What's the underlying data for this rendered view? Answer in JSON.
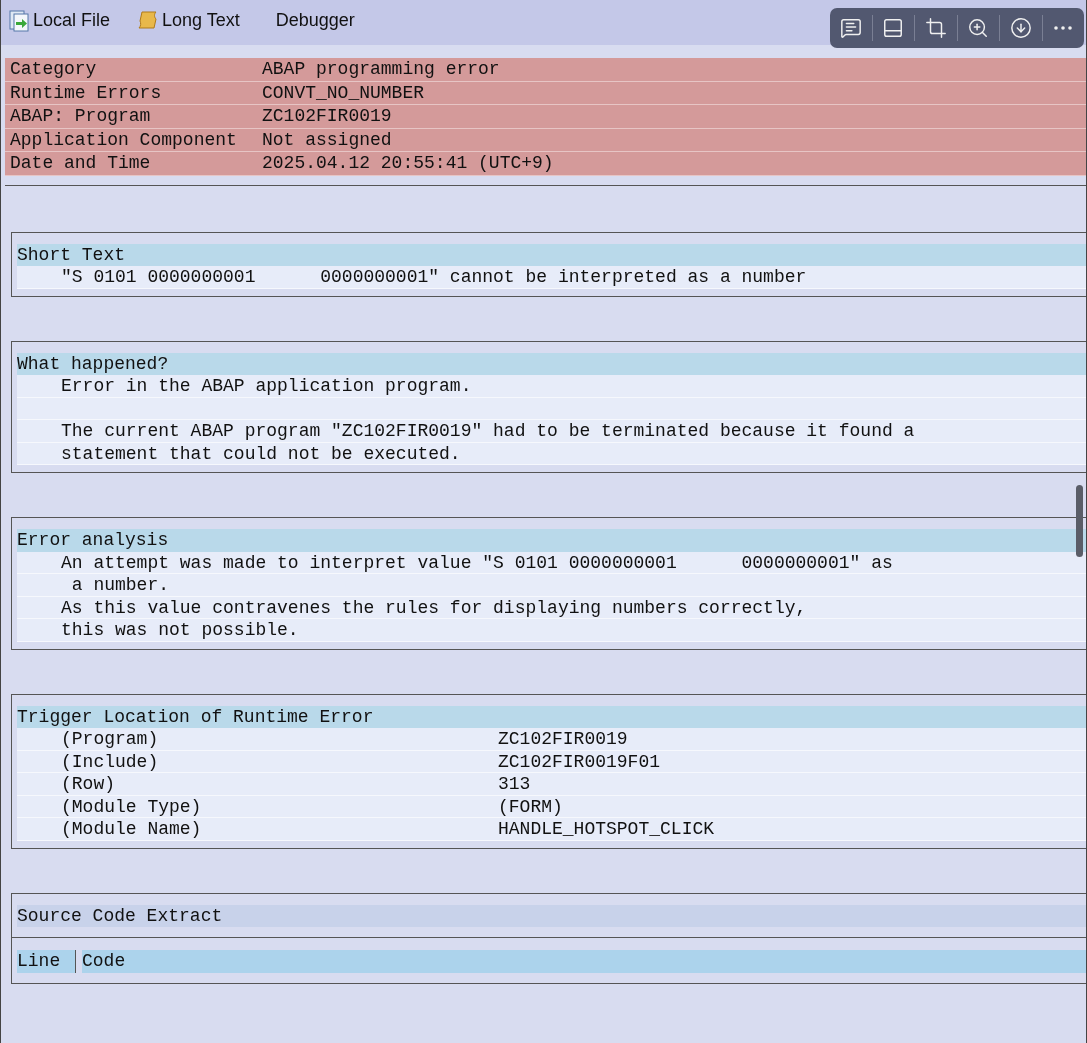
{
  "toolbar": {
    "buttons": [
      {
        "kind": "file",
        "label": "Local File"
      },
      {
        "kind": "scroll",
        "label": "Long Text"
      },
      {
        "kind": "plain",
        "label": "Debugger"
      }
    ]
  },
  "header": [
    {
      "label": "Category",
      "value": "ABAP programming error"
    },
    {
      "label": "Runtime Errors",
      "value": "CONVT_NO_NUMBER"
    },
    {
      "label": "ABAP: Program",
      "value": "ZC102FIR0019"
    },
    {
      "label": "Application Component",
      "value": "Not assigned"
    },
    {
      "label": "Date and Time",
      "value": "2025.04.12 20:55:41 (UTC+9)"
    }
  ],
  "sections": [
    {
      "kind": "text",
      "title": "Short Text",
      "paragraphs": [
        [
          "\"S 0101 0000000001      0000000001\" cannot be interpreted as a number"
        ]
      ]
    },
    {
      "kind": "text",
      "title": "What happened?",
      "paragraphs": [
        [
          "Error in the ABAP application program."
        ],
        [
          "The current ABAP program \"ZC102FIR0019\" had to be terminated because it found a",
          "statement that could not be executed."
        ]
      ]
    },
    {
      "kind": "text",
      "title": "Error analysis",
      "paragraphs": [
        [
          "An attempt was made to interpret value \"S 0101 0000000001      0000000001\" as",
          " a number.",
          "As this value contravenes the rules for displaying numbers correctly,",
          "this was not possible."
        ]
      ]
    },
    {
      "kind": "pairs",
      "title": "Trigger Location of Runtime Error",
      "rows": [
        {
          "label": "(Program)",
          "value": "ZC102FIR0019"
        },
        {
          "label": "(Include)",
          "value": "ZC102FIR0019F01"
        },
        {
          "label": "(Row)",
          "value": "313"
        },
        {
          "label": "(Module Type)",
          "value": "(FORM)"
        },
        {
          "label": "(Module Name)",
          "value": "HANDLE_HOTSPOT_CLICK"
        }
      ]
    },
    {
      "kind": "table",
      "title": "Source Code Extract",
      "columns": [
        "Line",
        "Code"
      ]
    }
  ]
}
